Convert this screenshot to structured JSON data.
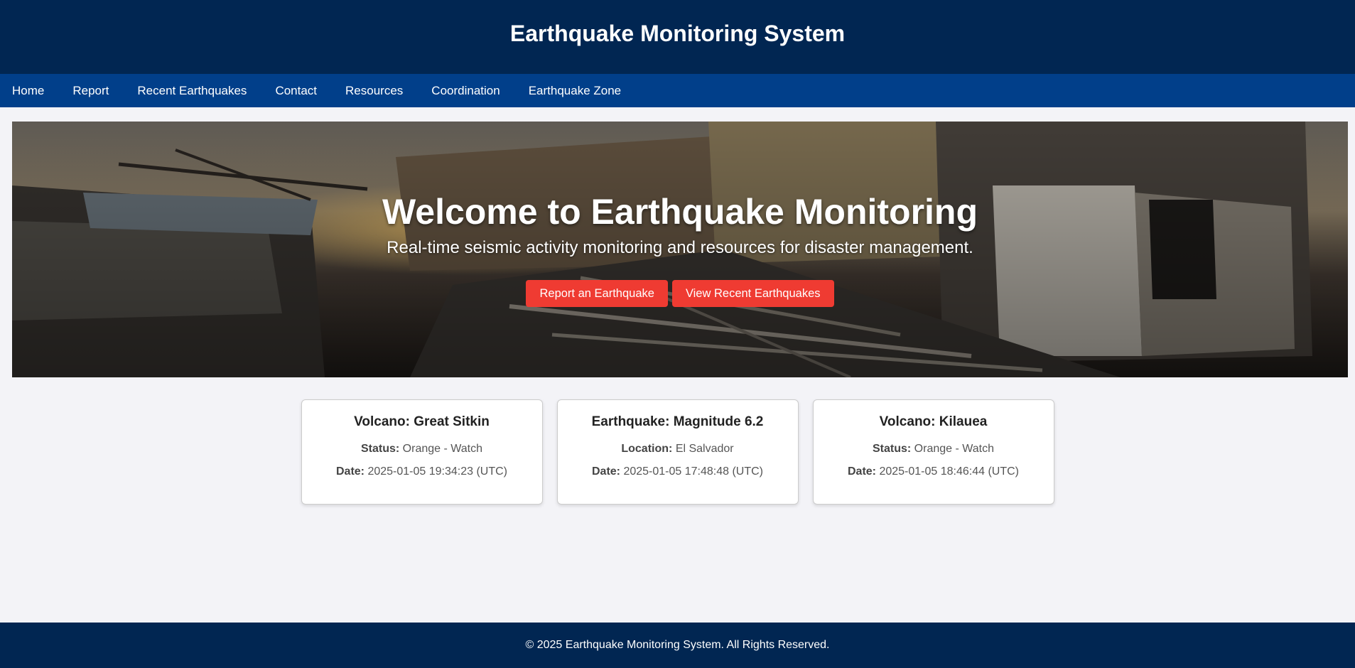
{
  "header": {
    "title": "Earthquake Monitoring System"
  },
  "nav": {
    "items": [
      {
        "label": "Home"
      },
      {
        "label": "Report"
      },
      {
        "label": "Recent Earthquakes"
      },
      {
        "label": "Contact"
      },
      {
        "label": "Resources"
      },
      {
        "label": "Coordination"
      },
      {
        "label": "Earthquake Zone"
      }
    ]
  },
  "hero": {
    "title": "Welcome to Earthquake Monitoring",
    "subtitle": "Real-time seismic activity monitoring and resources for disaster management.",
    "buttons": {
      "report_label": "Report an Earthquake",
      "recent_label": "View Recent Earthquakes"
    }
  },
  "cards": [
    {
      "title": "Volcano: Great Sitkin",
      "field1_label": "Status:",
      "field1_value": "Orange - Watch",
      "field2_label": "Date:",
      "field2_value": "2025-01-05 19:34:23 (UTC)"
    },
    {
      "title": "Earthquake: Magnitude 6.2",
      "field1_label": "Location:",
      "field1_value": "El Salvador",
      "field2_label": "Date:",
      "field2_value": "2025-01-05 17:48:48 (UTC)"
    },
    {
      "title": "Volcano: Kilauea",
      "field1_label": "Status:",
      "field1_value": "Orange - Watch",
      "field2_label": "Date:",
      "field2_value": "2025-01-05 18:46:44 (UTC)"
    }
  ],
  "footer": {
    "text": "© 2025 Earthquake Monitoring System. All Rights Reserved."
  },
  "colors": {
    "header_bg": "#012652",
    "nav_bg": "#013f8a",
    "button_bg": "#ef3b32",
    "page_bg": "#f3f3f7"
  }
}
